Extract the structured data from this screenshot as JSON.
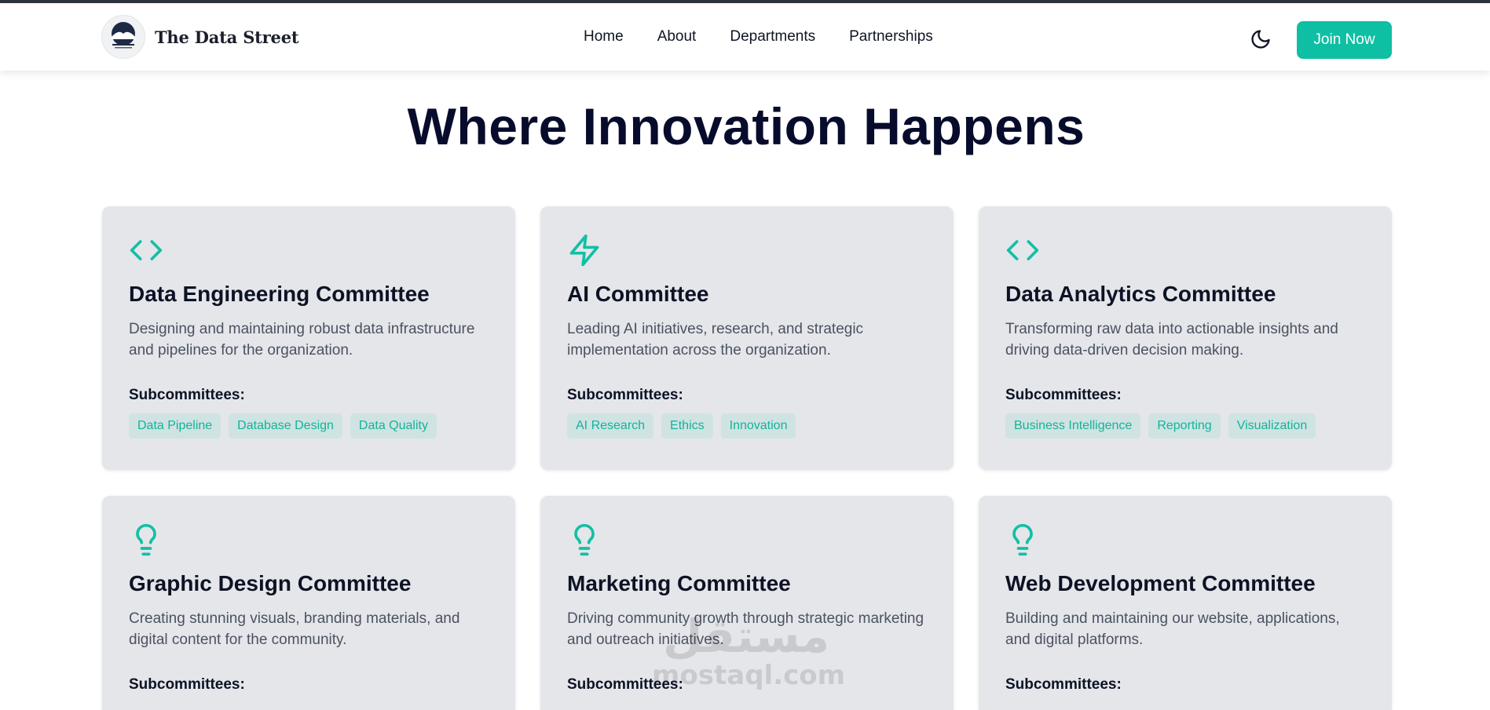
{
  "brand": {
    "name": "The Data Street",
    "logo_alt": "The Data Street logo"
  },
  "nav": {
    "items": [
      "Home",
      "About",
      "Departments",
      "Partnerships"
    ]
  },
  "header": {
    "theme_toggle_icon": "moon-icon",
    "join_label": "Join Now"
  },
  "colors": {
    "accent": "#0fbfa4",
    "heading": "#070c2c",
    "card_bg": "#e4e6ea",
    "tag_bg": "#cfe3e2"
  },
  "main": {
    "title": "Where Innovation Happens",
    "subcommittees_label": "Subcommittees:",
    "committees": [
      {
        "icon": "code-icon",
        "title": "Data Engineering Committee",
        "description": "Designing and maintaining robust data infrastructure and pipelines for the organization.",
        "tags": [
          "Data Pipeline",
          "Database Design",
          "Data Quality"
        ]
      },
      {
        "icon": "lightning-icon",
        "title": "AI Committee",
        "description": "Leading AI initiatives, research, and strategic implementation across the organization.",
        "tags": [
          "AI Research",
          "Ethics",
          "Innovation"
        ]
      },
      {
        "icon": "code-icon",
        "title": "Data Analytics Committee",
        "description": "Transforming raw data into actionable insights and driving data-driven decision making.",
        "tags": [
          "Business Intelligence",
          "Reporting",
          "Visualization"
        ]
      },
      {
        "icon": "lightbulb-icon",
        "title": "Graphic Design Committee",
        "description": "Creating stunning visuals, branding materials, and digital content for the community."
      },
      {
        "icon": "lightbulb-icon",
        "title": "Marketing Committee",
        "description": "Driving community growth through strategic marketing and outreach initiatives."
      },
      {
        "icon": "lightbulb-icon",
        "title": "Web Development Committee",
        "description": "Building and maintaining our website, applications, and digital platforms."
      }
    ]
  },
  "watermark": {
    "arabic": "مستقل",
    "latin": "mostaql.com"
  }
}
